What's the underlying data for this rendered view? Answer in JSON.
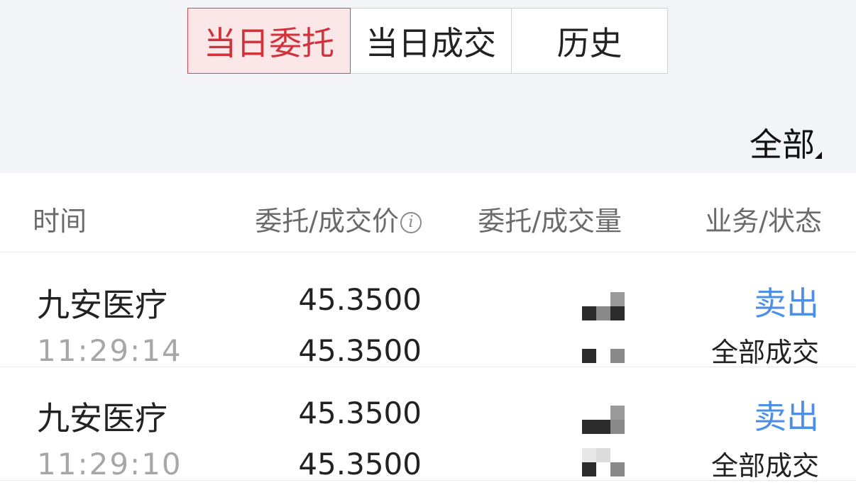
{
  "tabs": [
    {
      "label": "当日委托",
      "active": true
    },
    {
      "label": "当日成交",
      "active": false
    },
    {
      "label": "历史",
      "active": false
    }
  ],
  "filter": {
    "label": "全部"
  },
  "table": {
    "headers": {
      "time": "时间",
      "price": "委托/成交价",
      "quantity": "委托/成交量",
      "status": "业务/状态"
    },
    "rows": [
      {
        "name": "九安医疗",
        "time": "11:29:14",
        "order_price": "45.3500",
        "deal_price": "45.3500",
        "side": "卖出",
        "status": "全部成交"
      },
      {
        "name": "九安医疗",
        "time": "11:29:10",
        "order_price": "45.3500",
        "deal_price": "45.3500",
        "side": "卖出",
        "status": "全部成交"
      }
    ]
  },
  "colors": {
    "active_tab_text": "#d2323c",
    "active_tab_bg": "#fbe7e8",
    "sell_text": "#4d8fe8",
    "time_text": "#a7a7a7",
    "background_top": "#f3f4f8"
  }
}
